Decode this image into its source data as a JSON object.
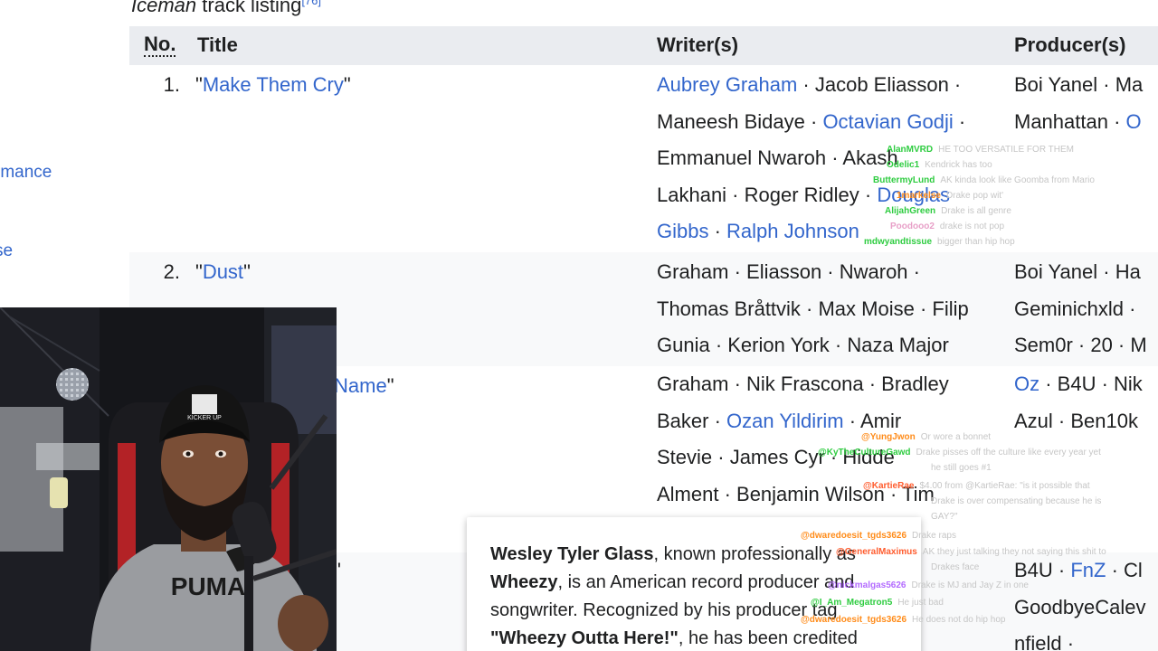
{
  "sidebar": {
    "items": [
      {
        "label": "rmance"
      },
      {
        "label": "se"
      }
    ],
    "dot": "."
  },
  "caption": {
    "title": "Iceman",
    "rest": " track listing",
    "ref": "[76]"
  },
  "table": {
    "headers": {
      "no": "No.",
      "title": "Title",
      "writers": "Writer(s)",
      "producers": "Producer(s)"
    },
    "rows": [
      {
        "no": "1.",
        "title_open": "\"",
        "title": "Make Them Cry",
        "title_close": "\"",
        "writer_lines": [
          [
            {
              "text": "Aubrey Graham",
              "link": true
            },
            {
              "text": " · Jacob Eliasson ·",
              "link": false
            }
          ],
          [
            {
              "text": "Maneesh Bidaye · ",
              "link": false
            },
            {
              "text": "Octavian Godji",
              "link": true
            },
            {
              "text": " ·",
              "link": false
            }
          ],
          [
            {
              "text": "Emmanuel Nwaroh · Akash",
              "link": false
            }
          ],
          [
            {
              "text": "Lakhani · Roger Ridley · ",
              "link": false
            },
            {
              "text": "Douglas",
              "link": true
            }
          ],
          [
            {
              "text": "Gibbs",
              "link": true
            },
            {
              "text": " · ",
              "link": false
            },
            {
              "text": "Ralph Johnson",
              "link": true
            }
          ]
        ],
        "producer_lines": [
          [
            {
              "text": "Boi Yanel · Ma",
              "link": false
            }
          ],
          [
            {
              "text": "Manhattan · ",
              "link": false
            },
            {
              "text": "O",
              "link": true
            }
          ]
        ]
      },
      {
        "no": "2.",
        "title_open": "\"",
        "title": "Dust",
        "title_close": "\"",
        "writer_lines": [
          [
            {
              "text": "Graham · Eliasson · Nwaroh ·",
              "link": false
            }
          ],
          [
            {
              "text": "Thomas Bråttvik · Max Moise · Filip",
              "link": false
            }
          ],
          [
            {
              "text": "Gunia · Kerion York · Naza Major",
              "link": false
            }
          ]
        ],
        "producer_lines": [
          [
            {
              "text": "Boi Yanel · Ha",
              "link": false
            }
          ],
          [
            {
              "text": "Geminichxld ·",
              "link": false
            }
          ],
          [
            {
              "text": "Sem0r · 20 · M",
              "link": false
            }
          ]
        ]
      },
      {
        "no": "",
        "title_open": "",
        "title": "Name",
        "title_close": "\"",
        "writer_lines": [
          [
            {
              "text": "Graham · Nik Frascona · Bradley",
              "link": false
            }
          ],
          [
            {
              "text": "Baker · ",
              "link": false
            },
            {
              "text": "Ozan Yildirim",
              "link": true
            },
            {
              "text": " · Amir",
              "link": false
            }
          ],
          [
            {
              "text": "Stevie · James Cyr · Hidde",
              "link": false
            }
          ],
          [
            {
              "text": "Alment · Benjamin Wilson · Tim",
              "link": false
            }
          ]
        ],
        "producer_lines": [
          [
            {
              "text": "Oz",
              "link": true
            },
            {
              "text": " · B4U · Nik",
              "link": false
            }
          ],
          [
            {
              "text": "Azul · Ben10k",
              "link": false
            }
          ]
        ]
      },
      {
        "no": "",
        "title_open": "",
        "title": "",
        "title_close": "\"",
        "writer_lines": [],
        "producer_lines": [
          [
            {
              "text": "B4U · ",
              "link": false
            },
            {
              "text": "FnZ",
              "link": true
            },
            {
              "text": " · Cl",
              "link": false
            }
          ],
          [
            {
              "text": "GoodbyeCalev",
              "link": false
            }
          ],
          [
            {
              "text": "nfield ·",
              "link": false
            }
          ]
        ]
      }
    ]
  },
  "popup": {
    "name": "Wesley Tyler Glass",
    "t1": ", known professionally as ",
    "alias": "Wheezy",
    "t2": ", is an American record producer and songwriter. Recognized by his producer tag ",
    "tag": "\"Wheezy Outta Here!\"",
    "t3": ", he has been credited"
  },
  "webcam": {
    "cap_text": "KICKER UP",
    "shirt_text": "PUMA"
  },
  "chat": [
    {
      "user": "AlanMVRD",
      "color": "#2ecc40",
      "text": "HE TOO VERSATILE FOR THEM"
    },
    {
      "user": "Odelic1",
      "color": "#2ecc40",
      "text": "Kendrick has too"
    },
    {
      "user": "ButtermyLund",
      "color": "#2ecc40",
      "text": "AK kinda look like Goomba from Mario"
    },
    {
      "user": "1markelse",
      "color": "#ff8c1a",
      "text": "Drake pop wit'"
    },
    {
      "user": "AlijahGreen",
      "color": "#2ecc40",
      "text": "Drake is all genre"
    },
    {
      "user": "Poodooo2",
      "color": "#e8a0c8",
      "text": "drake is not pop"
    },
    {
      "user": "mdwyandtissue",
      "color": "#2ecc40",
      "text": "bigger than hip hop"
    },
    {
      "user": "@YungJwon",
      "color": "#ff8c1a",
      "text": "Or wore a bonnet"
    },
    {
      "user": "@KyTheCultureGawd",
      "color": "#2ecc40",
      "text": "Drake pisses off the culture like every year yet"
    },
    {
      "user": "",
      "color": "#c6c6c6",
      "text": "he still goes #1"
    },
    {
      "user": "@KartieRae",
      "color": "#ff5c2e",
      "text": "$4.00 from @KartieRae: \"is it possible that"
    },
    {
      "user": "",
      "color": "#c6c6c6",
      "text": "Drake is over compensating because he is"
    },
    {
      "user": "",
      "color": "#c6c6c6",
      "text": "GAY?\""
    },
    {
      "user": "@dwaredoesit_tgds3626",
      "color": "#ff8c1a",
      "text": "Drake raps"
    },
    {
      "user": "@GeneralMaximus",
      "color": "#ff5c2e",
      "text": "AK they just talking they not saying this shit to"
    },
    {
      "user": "",
      "color": "#c6c6c6",
      "text": "Drakes face"
    },
    {
      "user": "@nickmalgas5626",
      "color": "#b36bff",
      "text": "Drake is MJ and Jay Z in one"
    },
    {
      "user": "@I_Am_Megatron5",
      "color": "#2ecc40",
      "text": "He just bad"
    },
    {
      "user": "@dwaredoesit_tgds3626",
      "color": "#ff8c1a",
      "text": "He does not do hip hop"
    }
  ]
}
